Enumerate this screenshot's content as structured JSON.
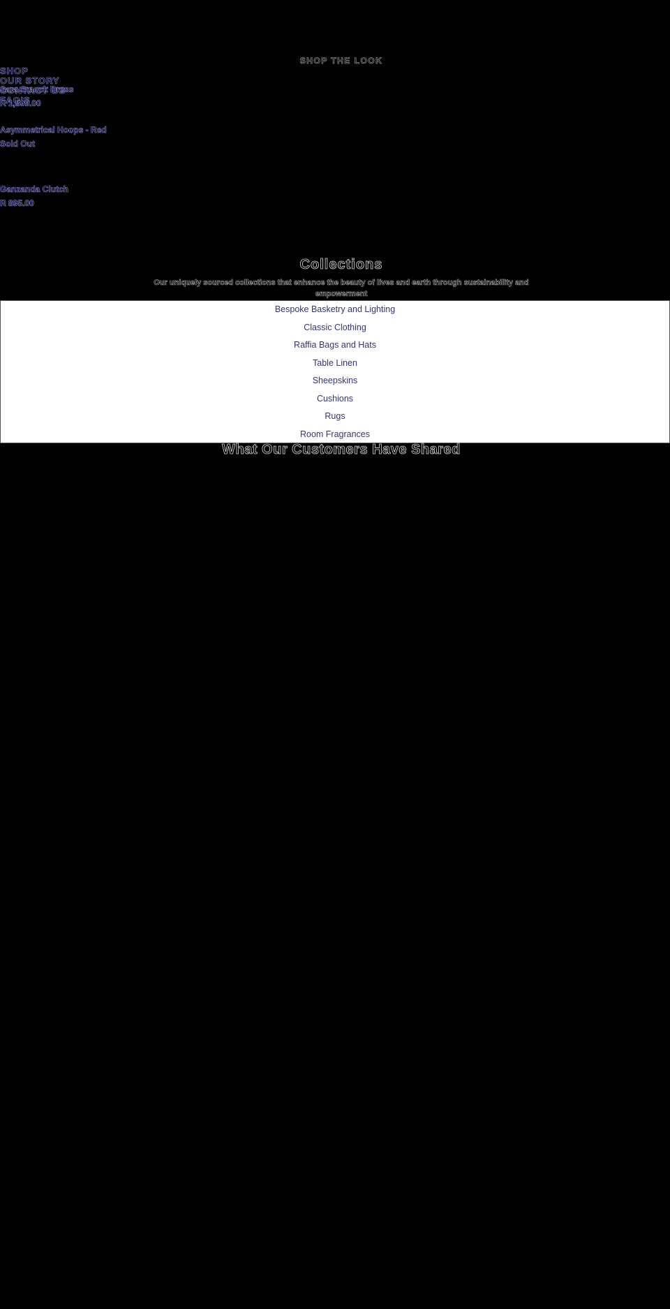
{
  "nav": {
    "items": [
      {
        "label": "SHOP"
      },
      {
        "label": "OUR STORY"
      },
      {
        "label": "CONTACT US"
      },
      {
        "label": "FAQ'S"
      }
    ]
  },
  "shop_the_look": {
    "title": "SHOP THE LOOK",
    "products": [
      {
        "name": "Sara Smock Dress",
        "price": "R 1,599.00"
      },
      {
        "name": "Asymmetrical Hoops - Red",
        "price": "Sold Out"
      },
      {
        "name": "Ganzanda Clutch",
        "price": "R 895.00"
      }
    ]
  },
  "collections": {
    "heading": "Collections",
    "description": "Our uniquely sourced collections that enhance the beauty of lives and earth through sustainability and empowerment",
    "items": [
      {
        "label": "Bespoke Basketry and Lighting"
      },
      {
        "label": "Classic Clothing"
      },
      {
        "label": "Raffia Bags and Hats"
      },
      {
        "label": "Table Linen"
      },
      {
        "label": "Sheepskins"
      },
      {
        "label": "Cushions"
      },
      {
        "label": "Rugs"
      },
      {
        "label": "Room Fragrances"
      }
    ]
  },
  "testimonials": {
    "heading": "What Our Customers Have Shared"
  },
  "colors": {
    "background": "#000000",
    "link": "#8c8ce6",
    "collection_link": "#33337a",
    "panel": "#ffffff"
  }
}
